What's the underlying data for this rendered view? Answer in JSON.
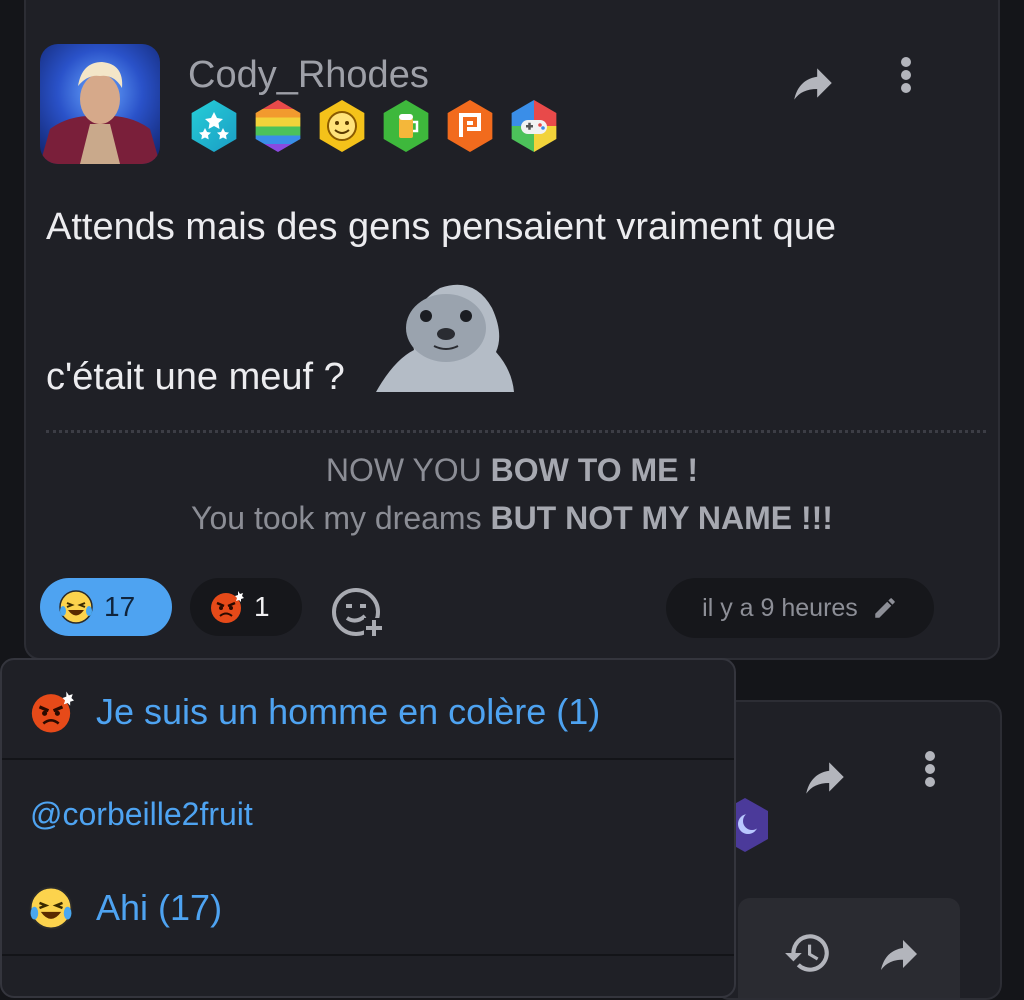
{
  "post": {
    "username": "Cody_Rhodes",
    "badges": [
      {
        "icon": "stars-badge-icon",
        "color": "#2ec4d6"
      },
      {
        "icon": "rainbow-badge-icon",
        "color": "#e84a4a"
      },
      {
        "icon": "smiley-badge-icon",
        "color": "#f4c21a"
      },
      {
        "icon": "beer-badge-icon",
        "color": "#3eb83c"
      },
      {
        "icon": "p-logo-badge-icon",
        "color": "#f26b1d"
      },
      {
        "icon": "gamepad-badge-icon",
        "color": "#4aa3e8"
      }
    ],
    "text_line1": "Attends mais des gens pensaient vraiment que",
    "text_line2": "c'était une meuf ?",
    "signature": {
      "line1_normal": "NOW YOU ",
      "line1_bold": "BOW TO ME !",
      "line2_normal": "You took my dreams ",
      "line2_bold": "BUT NOT MY NAME !!!"
    },
    "reactions": [
      {
        "emoji": "laughing-tears-emoji-icon",
        "count": "17"
      },
      {
        "emoji": "angry-face-emoji-icon",
        "count": "1"
      }
    ],
    "timestamp": "il y a 9 heures"
  },
  "popup": {
    "header": "Je suis un homme en colère (1)",
    "mention": "@corbeille2fruit",
    "laugh_row": "Ahi (17)"
  },
  "colors": {
    "accent": "#4ea3f1",
    "card_bg": "#1f2026",
    "page_bg": "#141519"
  }
}
